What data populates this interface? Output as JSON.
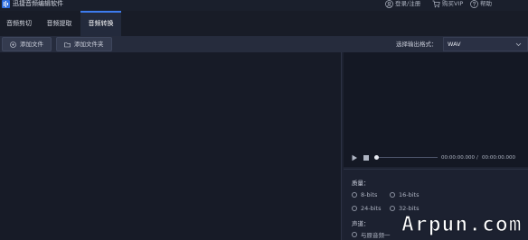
{
  "app": {
    "title": "迅捷音频编辑软件"
  },
  "top_actions": {
    "login": "登录/注册",
    "vip": "购买VIP",
    "help": "帮助"
  },
  "tabs": [
    {
      "label": "音频剪切",
      "active": false
    },
    {
      "label": "音频提取",
      "active": false
    },
    {
      "label": "音频转换",
      "active": true
    }
  ],
  "toolbar": {
    "add_file": "添加文件",
    "add_folder": "添加文件夹",
    "format_label": "选择输出格式：",
    "format_value": "WAV"
  },
  "player": {
    "current_time": "00:00:00.000",
    "separator": "/",
    "total_time": "00:00:00.000"
  },
  "settings": {
    "quality_label": "质量：",
    "bits": [
      "8-bits",
      "16-bits",
      "24-bits",
      "32-bits"
    ],
    "channel_label": "声道：",
    "channel_option": "与原音频一"
  },
  "watermark": {
    "text": "Arpun.com"
  },
  "colors": {
    "accent": "#3d7cf0",
    "background": "#1d2231",
    "panel": "#171b27"
  },
  "icons": [
    "app-logo",
    "user-icon",
    "cart-icon",
    "help-icon",
    "add-file-icon",
    "folder-icon",
    "chevron-down-icon",
    "play-icon",
    "stop-icon"
  ]
}
